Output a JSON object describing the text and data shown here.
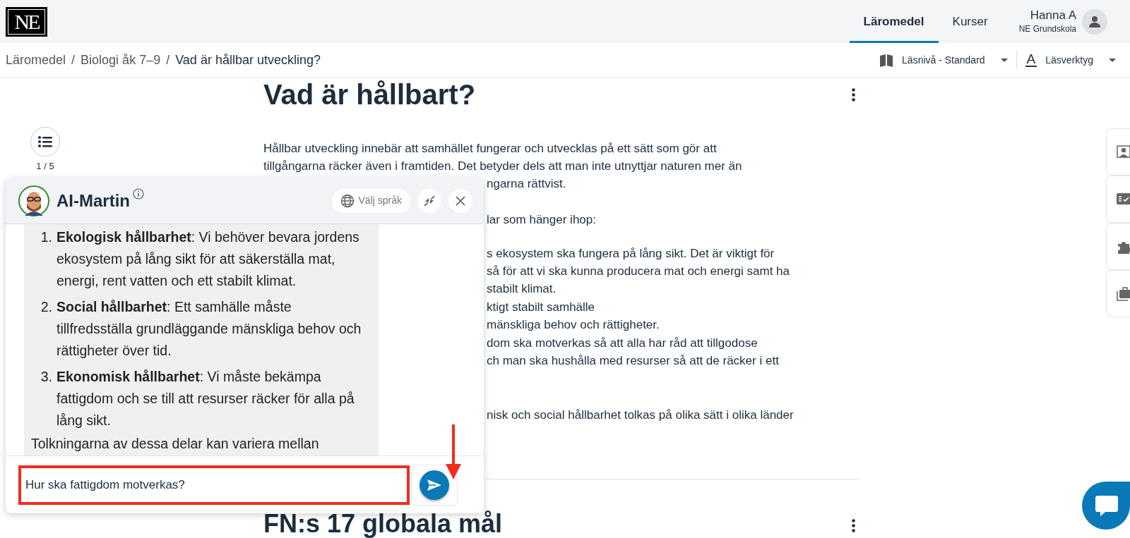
{
  "header": {
    "logo": "NE",
    "nav": [
      {
        "label": "Läromedel",
        "selected": true
      },
      {
        "label": "Kurser",
        "selected": false
      }
    ],
    "user": {
      "name": "Hanna A",
      "school": "NE Grundskola"
    }
  },
  "breadcrumb": {
    "separator": "/",
    "items": [
      "Läromedel",
      "Biologi åk 7–9",
      "Vad är hållbar utveckling?"
    ]
  },
  "tools": [
    {
      "kind": "level",
      "label": "Läsnivå - Standard"
    },
    {
      "kind": "reader",
      "icon_letter": "A",
      "label": "Läsverktyg"
    }
  ],
  "sidebar": {
    "page": "1 / 5"
  },
  "article": {
    "title": "Vad är hållbart?",
    "blocks": [
      {
        "kind": "paragraph",
        "lines": [
          {
            "text": "Hållbar utveckling innebär att samhället fungerar och utvecklas på ett sätt som gör att"
          },
          {
            "text": "tillgångarna räcker även i framtiden. Det betyder dels att man inte utnyttjar naturen mer än"
          },
          {
            "text": "ngarna rättvist.",
            "clipped": true
          }
        ]
      },
      {
        "kind": "paragraph",
        "lines": [
          {
            "text": "lar som hänger ihop:",
            "clipped": true
          }
        ]
      },
      {
        "kind": "list",
        "items": [
          [
            {
              "text": "s ekosystem ska fungera på lång sikt. Det är viktigt för",
              "clipped": true
            },
            {
              "text": "så för att vi ska kunna producera mat och energi samt ha",
              "clipped": true
            },
            {
              "text": "stabilt klimat.",
              "clipped": true
            }
          ],
          [
            {
              "text": "ktigt stabilt samhälle",
              "clipped": true
            },
            {
              "text": "mänskliga behov och rättigheter.",
              "clipped": true
            }
          ],
          [
            {
              "text": "dom ska motverkas så att alla har råd att tillgodose",
              "clipped": true
            },
            {
              "text": "ch man ska hushålla med resurser så att de räcker i ett",
              "clipped": true
            }
          ]
        ]
      },
      {
        "kind": "paragraph",
        "lines": [
          {
            "text": "nisk och social hållbarhet tolkas på olika sätt i olika länder",
            "clipped": true
          }
        ]
      }
    ],
    "next_title": "FN:s 17 globala mål"
  },
  "chat": {
    "name": "AI-Martin",
    "language_button": "Välj språk",
    "items": [
      {
        "number": "1.",
        "text": "**Ekologisk hållbarhet**: Vi behöver bevara jordens ekosystem på lång sikt för att säkerställa mat, energi, rent vatten och ett stabilt klimat."
      },
      {
        "number": "2.",
        "text": "**Social hållbarhet**: Ett samhälle måste tillfredsställa grundläggande mänskliga behov och rättigheter över tid."
      },
      {
        "number": "3.",
        "text": "**Ekonomisk hållbarhet**: Vi måste bekämpa fattigdom och se till att resurser räcker för alla på lång sikt."
      }
    ],
    "trailing": "Tolkningarna av dessa delar kan variera mellan",
    "input": {
      "value": "Hur ska fattigdom motverkas?"
    }
  }
}
